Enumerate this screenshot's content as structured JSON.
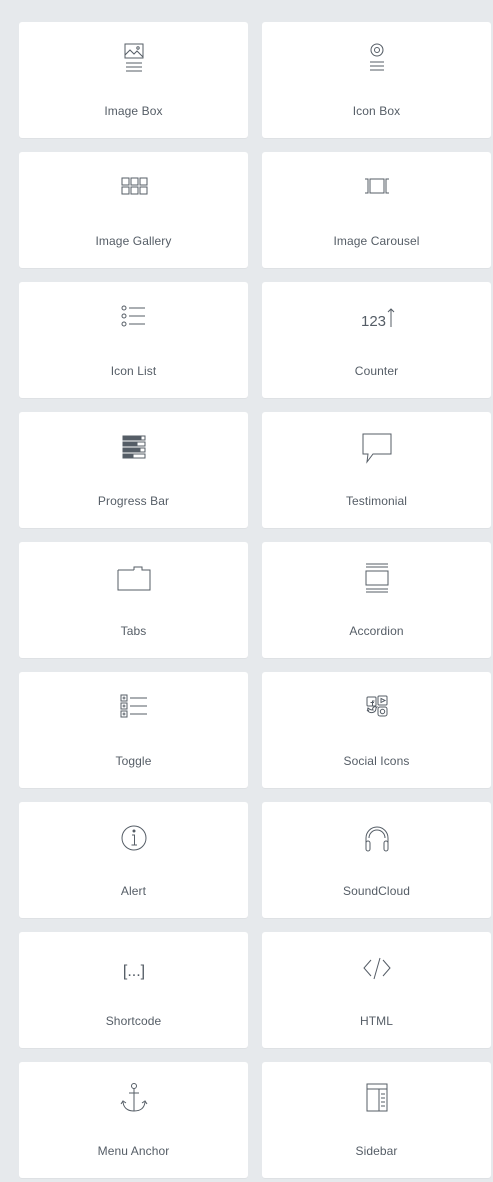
{
  "widgets": [
    {
      "label": "Image Box",
      "icon": "image-box-icon"
    },
    {
      "label": "Icon Box",
      "icon": "icon-box-icon"
    },
    {
      "label": "Image Gallery",
      "icon": "image-gallery-icon"
    },
    {
      "label": "Image Carousel",
      "icon": "image-carousel-icon"
    },
    {
      "label": "Icon List",
      "icon": "icon-list-icon"
    },
    {
      "label": "Counter",
      "icon": "counter-icon",
      "icon_text": "123"
    },
    {
      "label": "Progress Bar",
      "icon": "progress-bar-icon"
    },
    {
      "label": "Testimonial",
      "icon": "testimonial-icon"
    },
    {
      "label": "Tabs",
      "icon": "tabs-icon"
    },
    {
      "label": "Accordion",
      "icon": "accordion-icon"
    },
    {
      "label": "Toggle",
      "icon": "toggle-icon"
    },
    {
      "label": "Social Icons",
      "icon": "social-icons-icon"
    },
    {
      "label": "Alert",
      "icon": "alert-icon"
    },
    {
      "label": "SoundCloud",
      "icon": "soundcloud-icon"
    },
    {
      "label": "Shortcode",
      "icon": "shortcode-icon",
      "icon_text": "[...]"
    },
    {
      "label": "HTML",
      "icon": "html-icon"
    },
    {
      "label": "Menu Anchor",
      "icon": "menu-anchor-icon"
    },
    {
      "label": "Sidebar",
      "icon": "sidebar-icon"
    }
  ],
  "colors": {
    "background": "#e6e9ec",
    "tile": "#ffffff",
    "icon_stroke": "#555d66",
    "label": "#555d66"
  }
}
